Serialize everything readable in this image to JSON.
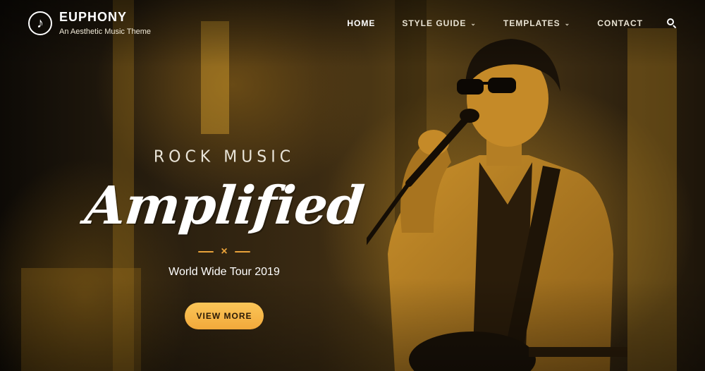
{
  "brand": {
    "name": "EUPHONY",
    "tagline": "An Aesthetic Music Theme",
    "logo_icon": "music-note-icon"
  },
  "nav": {
    "items": [
      {
        "label": "HOME",
        "active": true,
        "dropdown": false
      },
      {
        "label": "STYLE GUIDE",
        "active": false,
        "dropdown": true
      },
      {
        "label": "TEMPLATES",
        "active": false,
        "dropdown": true
      },
      {
        "label": "CONTACT",
        "active": false,
        "dropdown": false
      }
    ],
    "search_icon": "search-icon"
  },
  "hero": {
    "kicker": "ROCK MUSIC",
    "headline": "Amplified",
    "divider_symbol": "×",
    "subtitle": "World Wide Tour 2019",
    "cta_label": "VIEW MORE"
  },
  "colors": {
    "accent": "#f2a93b",
    "tint": "#c48e26"
  }
}
